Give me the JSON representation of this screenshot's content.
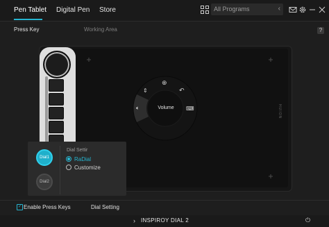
{
  "tabs": [
    {
      "label": "Pen Tablet",
      "active": true
    },
    {
      "label": "Digital Pen",
      "active": false
    },
    {
      "label": "Store",
      "active": false
    }
  ],
  "search": {
    "placeholder": "All Programs"
  },
  "toolbar_icons": [
    "apps-grid-icon",
    "chevron-left-icon",
    "mail-icon",
    "gear-icon",
    "minimize-icon",
    "close-icon"
  ],
  "subheader": {
    "left": "Press Key",
    "right": "Working Area",
    "help": "?"
  },
  "radial_menu": {
    "center_label": "Volume"
  },
  "tablet": {
    "brand": "HUION"
  },
  "dial_panel": {
    "buttons": [
      "Dial1",
      "Dial2"
    ],
    "title": "Dial Settir",
    "options": [
      {
        "label": "RaDial",
        "selected": true
      },
      {
        "label": "Customize",
        "selected": false
      }
    ]
  },
  "footer": {
    "enable_press_keys": "Enable Press Keys",
    "enable_checked": true,
    "dial_setting": "Dial Setting"
  },
  "device": {
    "name": "INSPIROY DIAL 2"
  },
  "colors": {
    "accent": "#26b5d0",
    "background": "#1e1e1e"
  }
}
